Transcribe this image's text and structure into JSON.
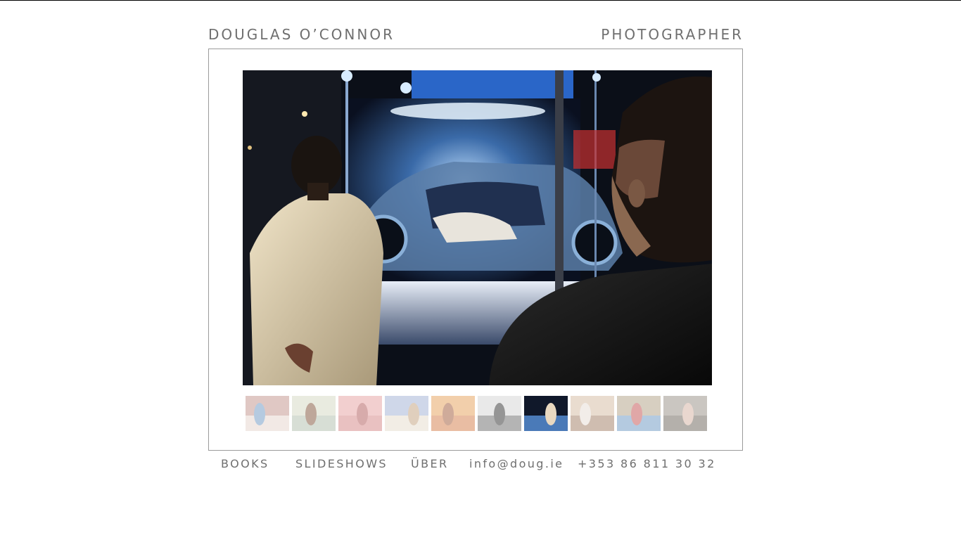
{
  "header": {
    "name": "DOUGLAS O’CONNOR",
    "title": "PHOTOGRAPHER"
  },
  "gallery": {
    "main_photo": "car-showroom-photo",
    "active_thumbnail_index": 6,
    "thumbnails": [
      {
        "name": "man-in-room-thumbnail",
        "colors": [
          "#c89c94",
          "#e8d8d0",
          "#7aa0c8"
        ]
      },
      {
        "name": "bedroom-window-thumbnail",
        "colors": [
          "#d8dcc8",
          "#b8c4b4",
          "#8a6048"
        ]
      },
      {
        "name": "pink-room-thumbnail",
        "colors": [
          "#e8a8a8",
          "#d89090",
          "#b86868"
        ]
      },
      {
        "name": "building-sky-thumbnail",
        "colors": [
          "#a8b8d8",
          "#e8e0d0",
          "#c8a888"
        ]
      },
      {
        "name": "crowd-festival-thumbnail",
        "colors": [
          "#e8a868",
          "#d88858",
          "#a86848"
        ]
      },
      {
        "name": "street-people-thumbnail",
        "colors": [
          "#d8d8d8",
          "#787878",
          "#404040"
        ]
      },
      {
        "name": "car-showroom-thumbnail",
        "colors": [
          "#10182a",
          "#4a7ab8",
          "#e8d8c0"
        ]
      },
      {
        "name": "shop-interior-thumbnail",
        "colors": [
          "#d8c0a8",
          "#a88870",
          "#e8e0d8"
        ]
      },
      {
        "name": "market-crowd-thumbnail",
        "colors": [
          "#b8a890",
          "#78a0c8",
          "#c86060"
        ]
      },
      {
        "name": "woman-portrait-thumbnail",
        "colors": [
          "#a09890",
          "#787068",
          "#d8b8a8"
        ]
      }
    ]
  },
  "nav": {
    "books": "BOOKS",
    "slideshows": "SLIDESHOWS",
    "uber": "ÜBER",
    "email": "info@doug.ie",
    "phone": "+353 86 811 30 32"
  },
  "colors": {
    "text": "#6f6f6f",
    "frame_border": "#9a9a9a"
  }
}
